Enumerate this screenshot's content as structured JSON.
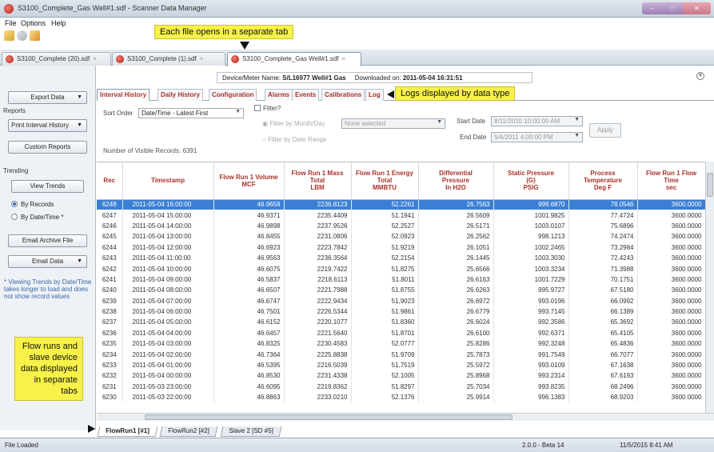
{
  "window": {
    "title": "S3100_Complete_Gas Well#1.sdf - Scanner Data Manager"
  },
  "menu": [
    "File",
    "Options",
    "Help"
  ],
  "doc_tabs": [
    {
      "label": "S3100_Complete (20).sdf",
      "close": "×"
    },
    {
      "label": "S3100_Complete (1).sdf",
      "close": "×"
    },
    {
      "label": "S3100_Complete_Gas Well#1.sdf",
      "close": "×"
    }
  ],
  "callouts": {
    "tab_callout": "Each file opens in a separate tab",
    "log_callout": "Logs displayed by data type",
    "flow_callout": "Flow runs and slave device data displayed in separate tabs"
  },
  "device": {
    "name_label": "Device/Meter Name:",
    "name_value": "S/L16977 Well#1 Gas",
    "downloaded_label": "Downloaded on:",
    "downloaded_value": "2011-05-04 16:31:51"
  },
  "sidebar": {
    "export_data": "Export Data",
    "reports_label": "Reports",
    "print_interval": "Print Interval History",
    "custom_reports": "Custom Reports",
    "trending_label": "Trending",
    "view_trends": "View Trends",
    "by_records": "By Records",
    "by_datetime": "By Date/Time *",
    "email_archive": "Email Archive File",
    "email_data": "Email Data",
    "note": "* Viewing Trends by Date/Time takes longer to load and does not show record values"
  },
  "inner_tabs": [
    "Interval History",
    "Daily History",
    "Configuration",
    "Alarms",
    "Events",
    "Calibrations",
    "Log"
  ],
  "filters": {
    "sort_order_label": "Sort Order",
    "sort_order_value": "Date/Time - Latest First",
    "filter_label": "Filter?",
    "filter_month": "Filter by Month/Day",
    "none_selected": "None selected",
    "filter_range": "Filter by Date Range",
    "start_label": "Start Date",
    "start_value": "8/11/2010 10:00:00 AM",
    "end_label": "End Date",
    "end_value": "5/4/2011 4:00:00 PM",
    "apply": "Apply",
    "visible_records_label": "Number of Visible Records:",
    "visible_records_value": "6391"
  },
  "table": {
    "headers": [
      [
        "Rec"
      ],
      [
        "Timestamp"
      ],
      [
        "Flow Run 1 Volume",
        "MCF"
      ],
      [
        "Flow Run 1 Mass",
        "Total",
        "LBM"
      ],
      [
        "Flow Run 1 Energy",
        "Total",
        "MMBTU"
      ],
      [
        "Differential",
        "Pressure",
        "In H2O"
      ],
      [
        "Static Pressure",
        "(G)",
        "PSIG"
      ],
      [
        "Process",
        "Temperature",
        "Deg F"
      ],
      [
        "Flow Run 1 Flow",
        "Time",
        "sec"
      ]
    ],
    "rows": [
      [
        "6248",
        "2011-05-04 16:00:00",
        "46.9659",
        "2236.8123",
        "52.2261",
        "26.7563",
        "999.6870",
        "78.0546",
        "3600.0000"
      ],
      [
        "6247",
        "2011-05-04 15:00:00",
        "46.9371",
        "2235.4409",
        "51.1941",
        "26.5609",
        "1001.9825",
        "77.4724",
        "3600.0000"
      ],
      [
        "6246",
        "2011-05-04 14:00:00",
        "46.9898",
        "2237.9526",
        "52.2527",
        "26.5171",
        "1003.0107",
        "75.6896",
        "3600.0000"
      ],
      [
        "6245",
        "2011-05-04 13:00:00",
        "46.8455",
        "2231.0806",
        "52.0923",
        "26.2562",
        "998.1213",
        "74.2474",
        "3600.0000"
      ],
      [
        "6244",
        "2011-05-04 12:00:00",
        "46.6923",
        "2223.7842",
        "51.9219",
        "26.1051",
        "1002.2465",
        "73.2984",
        "3600.0000"
      ],
      [
        "6243",
        "2011-05-04 11:00:00",
        "46.9563",
        "2236.3564",
        "52.2154",
        "26.1445",
        "1003.3030",
        "72.4243",
        "3600.0000"
      ],
      [
        "6242",
        "2011-05-04 10:00:00",
        "46.6075",
        "2219.7422",
        "51.8275",
        "25.6566",
        "1003.3234",
        "71.3988",
        "3600.0000"
      ],
      [
        "6241",
        "2011-05-04 09:00:00",
        "46.5837",
        "2218.6113",
        "51.8011",
        "26.6163",
        "1001.7229",
        "70.1751",
        "3600.0000"
      ],
      [
        "6240",
        "2011-05-04 08:00:00",
        "46.6507",
        "2221.7988",
        "51.8755",
        "26.6263",
        "995.9727",
        "67.5180",
        "3600.0000"
      ],
      [
        "6239",
        "2011-05-04 07:00:00",
        "46.6747",
        "2222.9434",
        "51.9023",
        "26.6972",
        "993.0196",
        "66.0992",
        "3600.0000"
      ],
      [
        "6238",
        "2011-05-04 06:00:00",
        "46.7501",
        "2226.5344",
        "51.9861",
        "26.6779",
        "993.7145",
        "66.1389",
        "3600.0000"
      ],
      [
        "6237",
        "2011-05-04 05:00:00",
        "46.6152",
        "2220.1077",
        "51.8360",
        "26.6024",
        "992.3586",
        "65.3692",
        "3600.0000"
      ],
      [
        "6236",
        "2011-05-04 04:00:00",
        "46.6457",
        "2221.5640",
        "51.8701",
        "26.6100",
        "992.6371",
        "65.4105",
        "3600.0000"
      ],
      [
        "6235",
        "2011-05-04 03:00:00",
        "46.8325",
        "2230.4583",
        "52.0777",
        "25.8286",
        "992.3248",
        "65.4836",
        "3600.0000"
      ],
      [
        "6234",
        "2011-05-04 02:00:00",
        "46.7364",
        "2225.8838",
        "51.9709",
        "25.7873",
        "991.7549",
        "66.7077",
        "3600.0000"
      ],
      [
        "6233",
        "2011-05-04 01:00:00",
        "46.5395",
        "2216.5039",
        "51.7519",
        "25.5972",
        "993.0109",
        "67.1638",
        "3600.0000"
      ],
      [
        "6232",
        "2011-05-04 00:00:00",
        "46.8530",
        "2231.4338",
        "52.1005",
        "25.8968",
        "993.2314",
        "67.6193",
        "3600.0000"
      ],
      [
        "6231",
        "2011-05-03 23:00:00",
        "46.6095",
        "2219.8362",
        "51.8297",
        "25.7034",
        "993.8235",
        "68.2496",
        "3600.0000"
      ],
      [
        "6230",
        "2011-05-03 22:00:00",
        "46.8863",
        "2233.0210",
        "52.1376",
        "25.9914",
        "996.1383",
        "68.9203",
        "3600.0000"
      ]
    ]
  },
  "bottom_tabs": [
    "FlowRun1 [#1]",
    "FlowRun2 [#2]",
    "Slave 2 [SD #5]"
  ],
  "status": {
    "left": "File Loaded",
    "version": "2.0.0 - Beta 14",
    "datetime": "11/5/2015 8:41 AM"
  },
  "colors": {
    "accent_red": "#a8322a",
    "selection_blue": "#3b7fd4",
    "callout_yellow": "#f7f14a"
  }
}
